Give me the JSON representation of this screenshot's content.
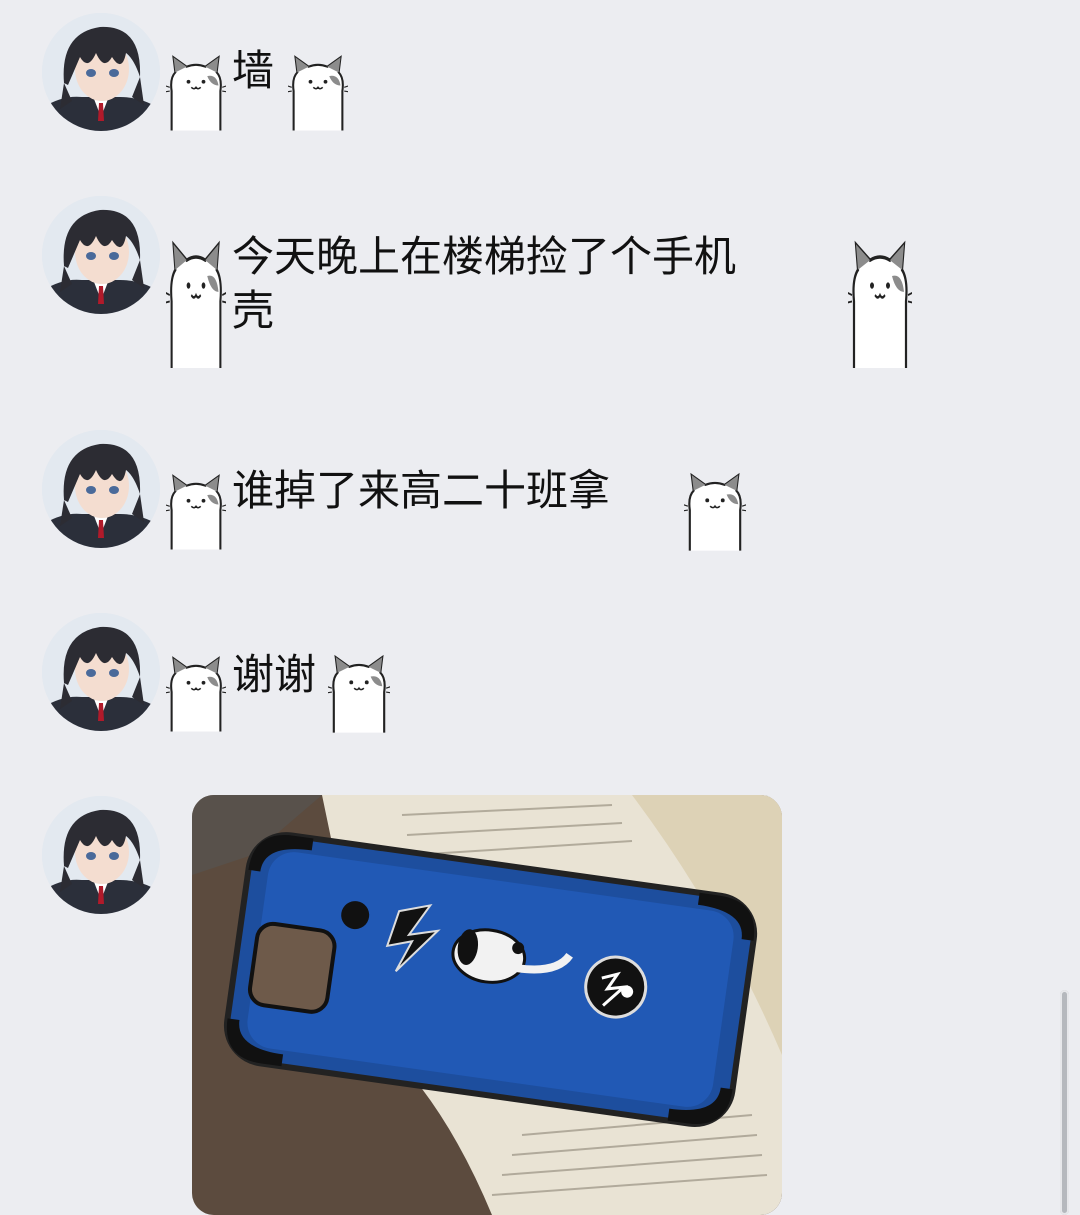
{
  "messages": [
    {
      "text": "墙"
    },
    {
      "text": "今天晚上在楼梯捡了个手机\n壳"
    },
    {
      "text": "谁掉了来高二十班拿"
    },
    {
      "text": "谢谢"
    }
  ],
  "photo": {
    "description_icons": [
      "lightning-icon",
      "snoopy-icon",
      "round-logo-icon"
    ]
  }
}
